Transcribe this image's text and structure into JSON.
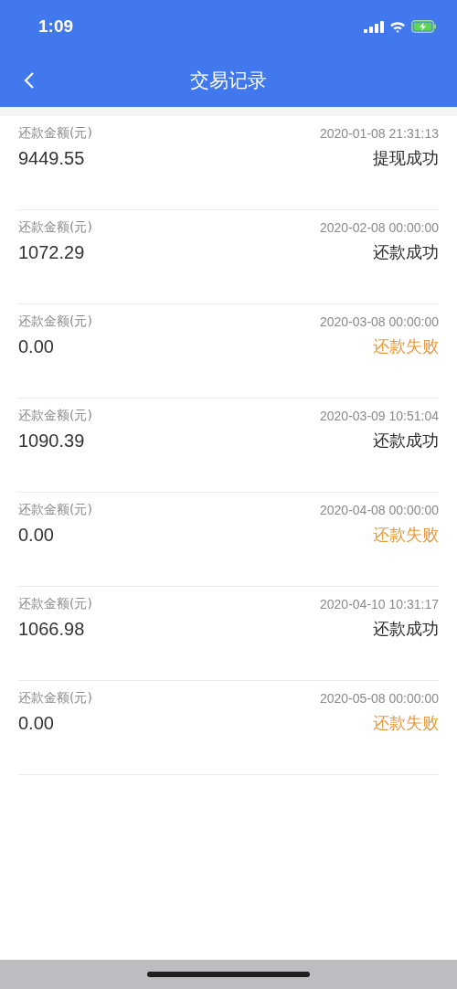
{
  "status_bar": {
    "time": "1:09"
  },
  "nav": {
    "title": "交易记录"
  },
  "records": [
    {
      "label": "还款金额(元)",
      "amount": "9449.55",
      "time": "2020-01-08 21:31:13",
      "status": "提现成功",
      "kind": "success"
    },
    {
      "label": "还款金额(元)",
      "amount": "1072.29",
      "time": "2020-02-08 00:00:00",
      "status": "还款成功",
      "kind": "success"
    },
    {
      "label": "还款金额(元)",
      "amount": "0.00",
      "time": "2020-03-08 00:00:00",
      "status": "还款失败",
      "kind": "failure"
    },
    {
      "label": "还款金额(元)",
      "amount": "1090.39",
      "time": "2020-03-09 10:51:04",
      "status": "还款成功",
      "kind": "success"
    },
    {
      "label": "还款金额(元)",
      "amount": "0.00",
      "time": "2020-04-08 00:00:00",
      "status": "还款失败",
      "kind": "failure"
    },
    {
      "label": "还款金额(元)",
      "amount": "1066.98",
      "time": "2020-04-10 10:31:17",
      "status": "还款成功",
      "kind": "success"
    },
    {
      "label": "还款金额(元)",
      "amount": "0.00",
      "time": "2020-05-08 00:00:00",
      "status": "还款失败",
      "kind": "failure"
    }
  ]
}
